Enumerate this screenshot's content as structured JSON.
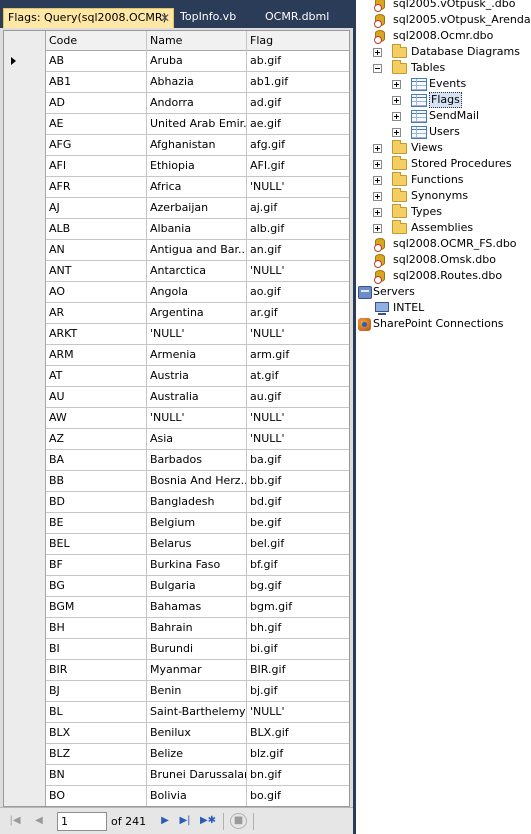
{
  "tabs": [
    {
      "label": "Flags: Query(sql2008.OCMR)",
      "active": true
    },
    {
      "label": "TopInfo.vb",
      "active": false
    },
    {
      "label": "OCMR.dbml",
      "active": false
    }
  ],
  "grid": {
    "columns": [
      "Code",
      "Name",
      "Flag"
    ],
    "rows": [
      [
        "AB",
        "Aruba",
        "ab.gif"
      ],
      [
        "AB1",
        "Abhazia",
        "ab1.gif"
      ],
      [
        "AD",
        "Andorra",
        "ad.gif"
      ],
      [
        "AE",
        "United Arab Emir...",
        "ae.gif"
      ],
      [
        "AFG",
        "Afghanistan",
        "afg.gif"
      ],
      [
        "AFI",
        "Ethiopia",
        "AFI.gif"
      ],
      [
        "AFR",
        "Africa",
        "'NULL'"
      ],
      [
        "AJ",
        "Azerbaijan",
        "aj.gif"
      ],
      [
        "ALB",
        "Albania",
        "alb.gif"
      ],
      [
        "AN",
        "Antigua and Bar...",
        "an.gif"
      ],
      [
        "ANT",
        "Antarctica",
        "'NULL'"
      ],
      [
        "AO",
        "Angola",
        "ao.gif"
      ],
      [
        "AR",
        "Argentina",
        "ar.gif"
      ],
      [
        "ARKT",
        "'NULL'",
        "'NULL'"
      ],
      [
        "ARM",
        "Armenia",
        "arm.gif"
      ],
      [
        "AT",
        "Austria",
        "at.gif"
      ],
      [
        "AU",
        "Australia",
        "au.gif"
      ],
      [
        "AW",
        "'NULL'",
        "'NULL'"
      ],
      [
        "AZ",
        "Asia",
        "'NULL'"
      ],
      [
        "BA",
        "Barbados",
        "ba.gif"
      ],
      [
        "BB",
        "Bosnia And Herz...",
        "bb.gif"
      ],
      [
        "BD",
        "Bangladesh",
        "bd.gif"
      ],
      [
        "BE",
        "Belgium",
        "be.gif"
      ],
      [
        "BEL",
        "Belarus",
        "bel.gif"
      ],
      [
        "BF",
        "Burkina Faso",
        "bf.gif"
      ],
      [
        "BG",
        "Bulgaria",
        "bg.gif"
      ],
      [
        "BGM",
        "Bahamas",
        "bgm.gif"
      ],
      [
        "BH",
        "Bahrain",
        "bh.gif"
      ],
      [
        "BI",
        "Burundi",
        "bi.gif"
      ],
      [
        "BIR",
        "Myanmar",
        "BIR.gif"
      ],
      [
        "BJ",
        "Benin",
        "bj.gif"
      ],
      [
        "BL",
        "Saint-Barthelemy",
        "'NULL'"
      ],
      [
        "BLX",
        "Benilux",
        "BLX.gif"
      ],
      [
        "BLZ",
        "Belize",
        "blz.gif"
      ],
      [
        "BN",
        "Brunei Darussalam",
        "bn.gif"
      ],
      [
        "BO",
        "Bolivia",
        "bo.gif"
      ]
    ]
  },
  "navigator": {
    "current_page": "1",
    "of_label": "of 241"
  },
  "explorer": {
    "nodes": [
      {
        "label": "sql2005.vOtpusk_.dbo",
        "icon": "database-icon",
        "level": 0,
        "expander": "none"
      },
      {
        "label": "sql2005.vOtpusk_Arenda.dbo",
        "icon": "database-icon",
        "level": 0,
        "expander": "none"
      },
      {
        "label": "sql2008.Ocmr.dbo",
        "icon": "database-icon",
        "level": 0,
        "expander": "none"
      },
      {
        "label": "Database Diagrams",
        "icon": "folder-icon",
        "level": 1,
        "expander": "plus"
      },
      {
        "label": "Tables",
        "icon": "folder-icon",
        "level": 1,
        "expander": "minus"
      },
      {
        "label": "Events",
        "icon": "table-icon",
        "level": 2,
        "expander": "plus"
      },
      {
        "label": "Flags",
        "icon": "table-icon",
        "level": 2,
        "expander": "plus",
        "selected": true
      },
      {
        "label": "SendMail",
        "icon": "table-icon",
        "level": 2,
        "expander": "plus"
      },
      {
        "label": "Users",
        "icon": "table-icon",
        "level": 2,
        "expander": "plus"
      },
      {
        "label": "Views",
        "icon": "folder-icon",
        "level": 1,
        "expander": "plus"
      },
      {
        "label": "Stored Procedures",
        "icon": "folder-icon",
        "level": 1,
        "expander": "plus"
      },
      {
        "label": "Functions",
        "icon": "folder-icon",
        "level": 1,
        "expander": "plus"
      },
      {
        "label": "Synonyms",
        "icon": "folder-icon",
        "level": 1,
        "expander": "plus"
      },
      {
        "label": "Types",
        "icon": "folder-icon",
        "level": 1,
        "expander": "plus"
      },
      {
        "label": "Assemblies",
        "icon": "folder-icon",
        "level": 1,
        "expander": "plus"
      },
      {
        "label": "sql2008.OCMR_FS.dbo",
        "icon": "database-icon",
        "level": 0,
        "expander": "none"
      },
      {
        "label": "sql2008.Omsk.dbo",
        "icon": "database-icon",
        "level": 0,
        "expander": "none"
      },
      {
        "label": "sql2008.Routes.dbo",
        "icon": "database-icon",
        "level": 0,
        "expander": "none"
      },
      {
        "label": "Servers",
        "icon": "servers-icon",
        "level": -1,
        "expander": "none"
      },
      {
        "label": "INTEL",
        "icon": "computer-icon",
        "level": 0,
        "expander": "none"
      },
      {
        "label": "SharePoint Connections",
        "icon": "sharepoint-icon",
        "level": -1,
        "expander": "none"
      }
    ]
  }
}
